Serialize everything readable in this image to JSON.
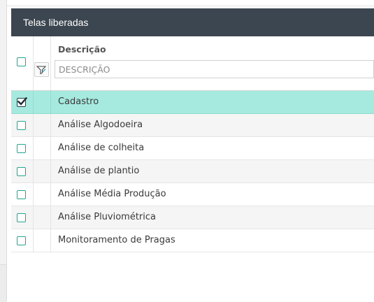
{
  "panel": {
    "title": "Telas liberadas",
    "column_header": "Descrição",
    "filter_placeholder": "DESCRIÇÃO"
  },
  "rows": [
    {
      "label": "Cadastro",
      "checked": true
    },
    {
      "label": "Análise Algodoeira",
      "checked": false
    },
    {
      "label": "Análise de colheita",
      "checked": false
    },
    {
      "label": "Análise de plantio",
      "checked": false
    },
    {
      "label": "Análise Média Produção",
      "checked": false
    },
    {
      "label": "Análise Pluviométrica",
      "checked": false
    },
    {
      "label": "Monitoramento de Pragas",
      "checked": false
    }
  ],
  "colors": {
    "header_bg": "#3c4650",
    "selected_row": "#a6eadf",
    "checkbox_accent": "#21a790"
  },
  "icons": {
    "filter": "filter-icon",
    "check": "check-icon"
  }
}
